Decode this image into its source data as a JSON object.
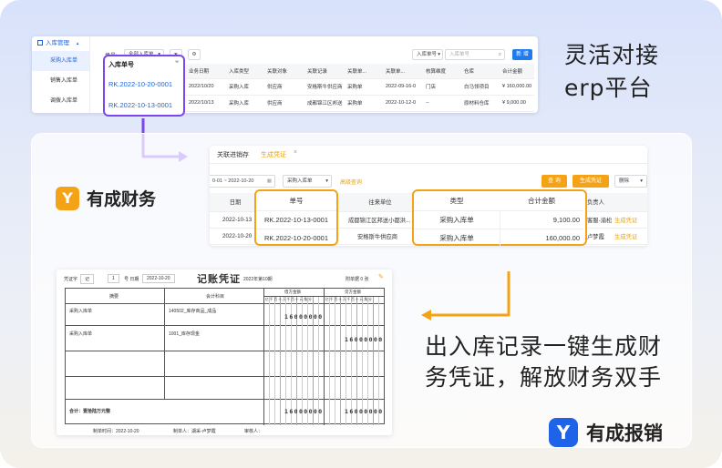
{
  "captions": {
    "top_line1": "灵活对接",
    "top_line2": "erp平台",
    "bottom_line1": "出入库记录一键生成财",
    "bottom_line2": "务凭证，解放财务双手"
  },
  "brands": {
    "finance": "有成财务",
    "reimburse": "有成报销",
    "logo_letter": "Y"
  },
  "erp": {
    "menu_title": "入库管理",
    "menu_items": [
      "采购入库单",
      "销售入库单",
      "调拨入库单"
    ],
    "scene_label": "场景:",
    "scene_value": "全部入库单",
    "search_field": "入库单号",
    "search_placeholder": "入库单号",
    "new_button": "新 增",
    "headers": [
      "业务日期",
      "入库类型",
      "关联对象",
      "关联记录",
      "关联单...",
      "关联单...",
      "核算维度",
      "仓库",
      "合计金额"
    ],
    "rows": [
      [
        "2022/10/20",
        "采购入库",
        "供应商",
        "安格斯牛供应商",
        "采购单",
        "2022-09-16-0",
        "门店",
        "白马领项目",
        "¥ 160,000.00"
      ],
      [
        "2022/10/13",
        "采购入库",
        "供应商",
        "成都锦江区邦送",
        "采购单",
        "2022-10-12-0",
        "--",
        "原材料仓库",
        "¥ 9,000.00"
      ]
    ],
    "highlight_header": "入库单号",
    "highlight_values": [
      "RK.2022-10-20-0001",
      "RK.2022-10-13-0001"
    ]
  },
  "finance": {
    "tabs": [
      "关联进销存",
      "生成凭证"
    ],
    "date_from": "0-01",
    "date_to": "2022-10-20",
    "type_select": "采购入库单",
    "advanced": "高级查询",
    "query_btn": "查 询",
    "gen_btn": "生成凭证",
    "delete_btn": "删除",
    "headers": [
      "日期",
      "单号",
      "往来单位",
      "类型",
      "合计金额",
      "负责人"
    ],
    "rows": [
      {
        "date": "2022-10-13",
        "no": "RK.2022-10-13-0001",
        "party": "成都锦江区邦送小都洪...",
        "type": "采购入库单",
        "amount": "9,100.00",
        "owner": "客服-渝松",
        "action": "生成凭证"
      },
      {
        "date": "2022-10-20",
        "no": "RK.2022-10-20-0001",
        "party": "安格斯牛供应商",
        "type": "采购入库单",
        "amount": "160,000.00",
        "owner": "卢梦霞",
        "action": "生成凭证"
      }
    ]
  },
  "voucher": {
    "title": "记账凭证",
    "period": "2022年第10期",
    "word_label": "凭证字",
    "word": "记",
    "no_label": "号 日期",
    "no": "1",
    "date": "2022-10-20",
    "attach": "附单据 0 张",
    "col_summary": "摘要",
    "col_account": "会计科目",
    "col_debit": "借方金额",
    "col_credit": "贷方金额",
    "digit_units": "亿千百十万千百十元角分",
    "lines": [
      {
        "summary": "采购入库单",
        "account": "140502_库存商品_成品",
        "debit": "16000000",
        "credit": ""
      },
      {
        "summary": "采购入库单",
        "account": "1001_库存现金",
        "debit": "",
        "credit": "16000000"
      }
    ],
    "total_label": "合计：壹拾陆万元整",
    "total_debit": "16000000",
    "total_credit": "16000000",
    "maker": "制单时间：2022-10-20",
    "maker_name": "制单人：湖采-卢梦霞",
    "auditor": "审核人："
  },
  "colors": {
    "purple": "#7b46ef",
    "orange": "#f5a316",
    "blue": "#1e7cf0"
  }
}
